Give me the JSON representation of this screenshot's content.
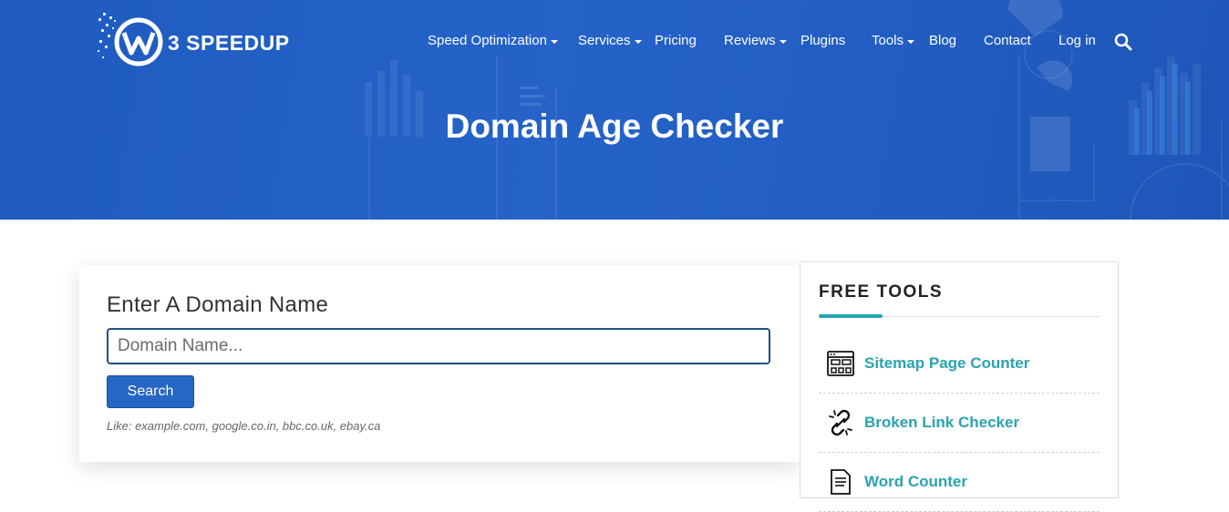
{
  "brand": {
    "name": "3 SPEEDUP"
  },
  "nav": {
    "items": [
      {
        "label": "Speed Optimization",
        "has_dropdown": true
      },
      {
        "label": "Services",
        "has_dropdown": true
      },
      {
        "label": "Pricing",
        "has_dropdown": false
      },
      {
        "label": "Reviews",
        "has_dropdown": true
      },
      {
        "label": "Plugins",
        "has_dropdown": false
      },
      {
        "label": "Tools",
        "has_dropdown": true
      },
      {
        "label": "Blog",
        "has_dropdown": false
      },
      {
        "label": "Contact",
        "has_dropdown": false
      },
      {
        "label": "Log in",
        "has_dropdown": false
      }
    ],
    "search_icon": "search-icon"
  },
  "hero": {
    "title": "Domain Age Checker"
  },
  "form": {
    "heading": "Enter A Domain Name",
    "input_placeholder": "Domain Name...",
    "input_value": "",
    "button_label": "Search",
    "hint": "Like: example.com, google.co.in, bbc.co.uk, ebay.ca"
  },
  "sidebar": {
    "title": "FREE TOOLS",
    "tools": [
      {
        "label": "Sitemap Page Counter",
        "icon": "sitemap-icon"
      },
      {
        "label": "Broken Link Checker",
        "icon": "broken-link-icon"
      },
      {
        "label": "Word Counter",
        "icon": "document-icon"
      }
    ]
  },
  "colors": {
    "hero_blue": "#2563c9",
    "accent_teal": "#2aa3b0",
    "button_blue": "#2666c4",
    "input_border": "#254f80"
  }
}
